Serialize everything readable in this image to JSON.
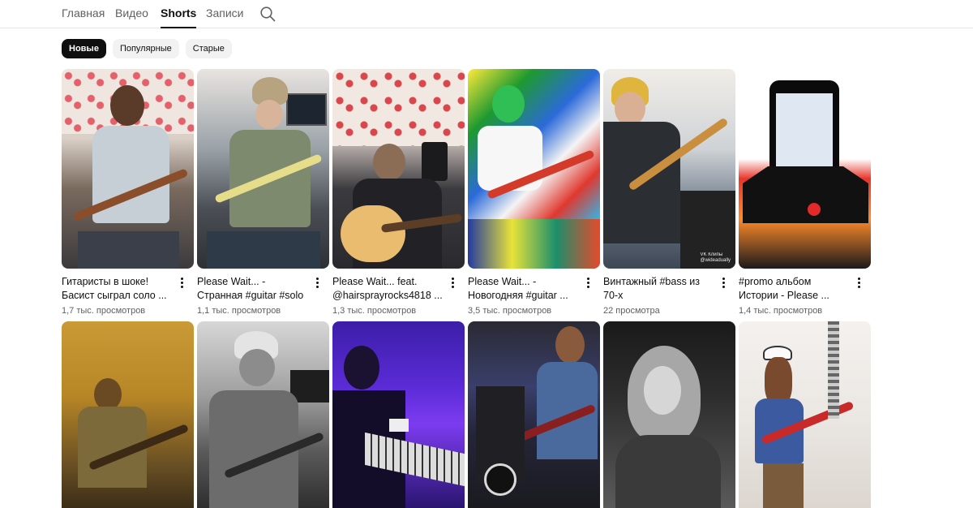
{
  "tabs": [
    {
      "label": "Главная"
    },
    {
      "label": "Видео"
    },
    {
      "label": "Shorts"
    },
    {
      "label": "Записи"
    }
  ],
  "search_icon": "search-icon",
  "chips": [
    {
      "label": "Новые",
      "active": true
    },
    {
      "label": "Популярные",
      "active": false
    },
    {
      "label": "Старые",
      "active": false
    }
  ],
  "shorts": [
    {
      "title_line1": "Гитаристы в шоке!",
      "title_line2": "Басист сыграл соло ...",
      "views": "1,7 тыс. просмотров"
    },
    {
      "title_line1": "Please Wait... -",
      "title_line2": "Странная #guitar #solo",
      "views": "1,1 тыс. просмотров"
    },
    {
      "title_line1": "Please Wait... feat.",
      "title_line2": "@hairsprayrocks4818 ...",
      "views": "1,3 тыс. просмотров"
    },
    {
      "title_line1": "Please Wait... -",
      "title_line2": "Новогодняя #guitar ...",
      "views": "3,5 тыс. просмотров"
    },
    {
      "title_line1": "Винтажный #bass из",
      "title_line2": "70-х",
      "views": "22 просмотра",
      "watermark_line1": "VK Клипы",
      "watermark_line2": "@wideadually"
    },
    {
      "title_line1": "#promo  альбом",
      "title_line2": "Истории - Please ...",
      "views": "1,4 тыс. просмотров"
    },
    {},
    {},
    {},
    {},
    {},
    {}
  ],
  "colors": {
    "accent": "#0f0f0f",
    "chip_bg": "#f2f2f2",
    "meta_text": "#606060"
  }
}
